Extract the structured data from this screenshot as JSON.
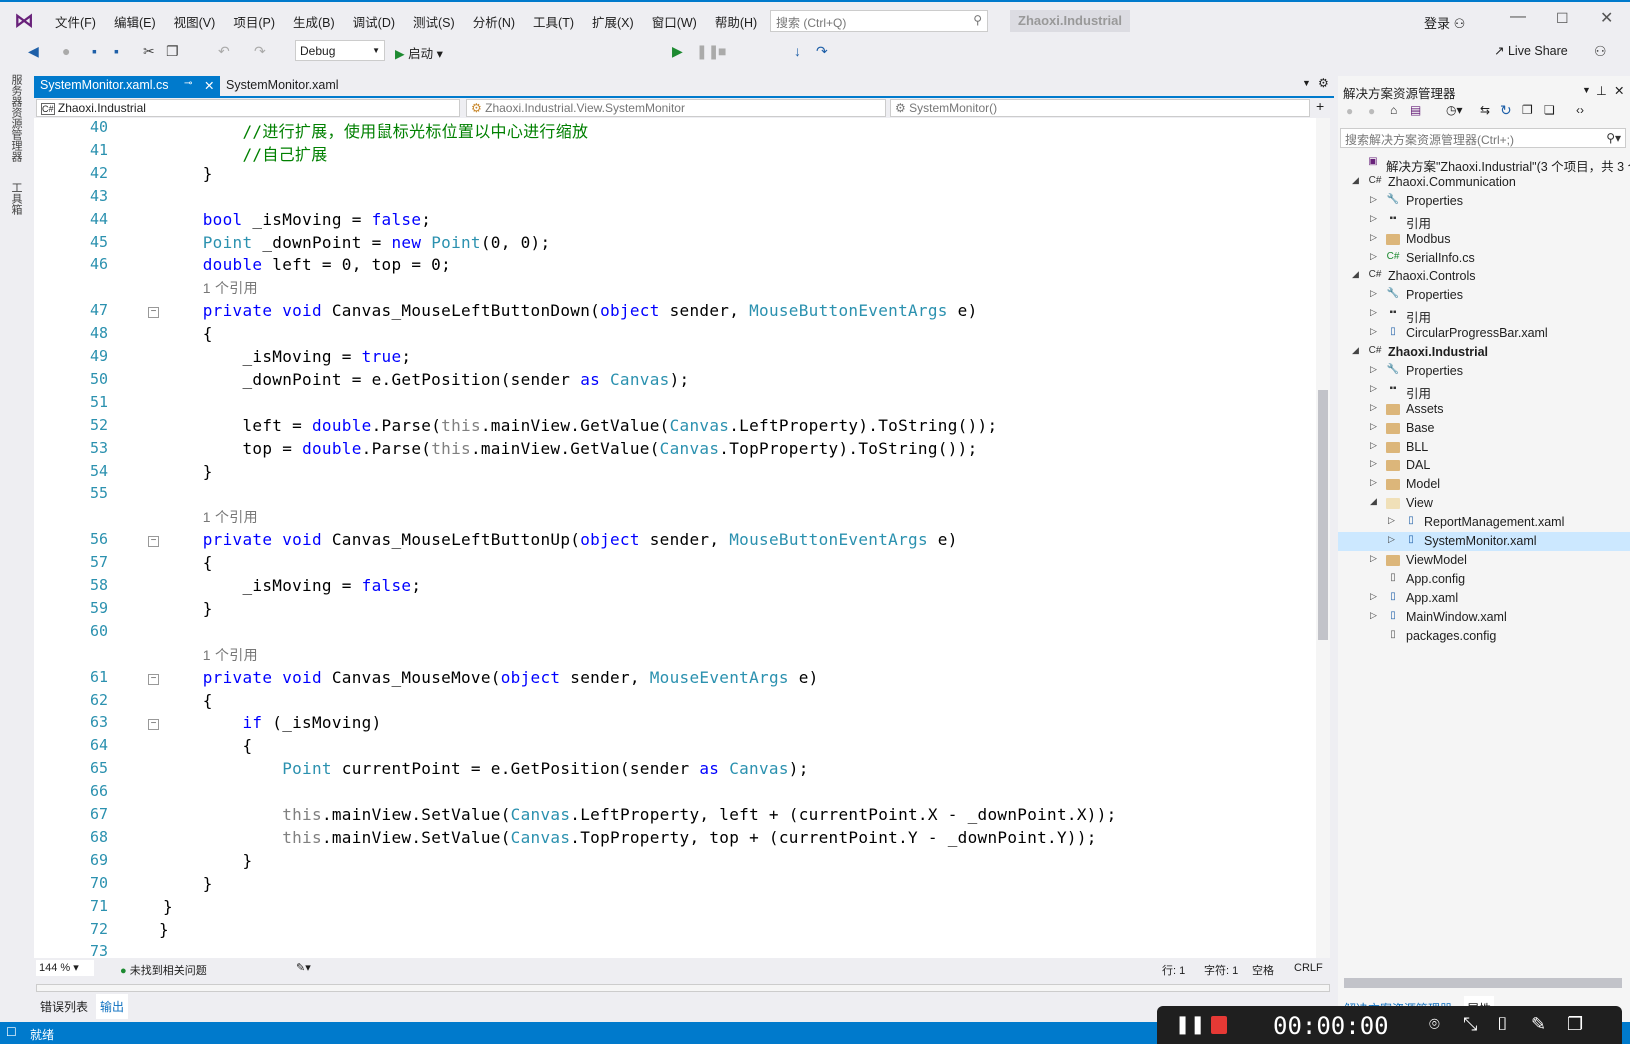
{
  "titlebar": {
    "menu": [
      "文件(F)",
      "编辑(E)",
      "视图(V)",
      "项目(P)",
      "生成(B)",
      "调试(D)",
      "测试(S)",
      "分析(N)",
      "工具(T)",
      "扩展(X)",
      "窗口(W)",
      "帮助(H)"
    ],
    "search_placeholder": "搜索 (Ctrl+Q)",
    "project": "Zhaoxi.Industrial",
    "login": "登录",
    "live_share": "Live Share"
  },
  "toolbar": {
    "config": "Debug",
    "start": "启动"
  },
  "left_strip": [
    "服务器资源管理器",
    "工具箱"
  ],
  "tabs": [
    {
      "label": "SystemMonitor.xaml.cs",
      "active": true
    },
    {
      "label": "SystemMonitor.xaml",
      "active": false
    }
  ],
  "navbar": {
    "project": "Zhaoxi.Industrial",
    "class": "Zhaoxi.Industrial.View.SystemMonitor",
    "member": "SystemMonitor()"
  },
  "code": [
    {
      "n": "40",
      "t": [
        [
          "cm",
          "        //进行扩展，使用鼠标光标位置以中心进行缩放"
        ]
      ]
    },
    {
      "n": "41",
      "t": [
        [
          "cm",
          "        //自己扩展"
        ]
      ]
    },
    {
      "n": "42",
      "t": [
        [
          "",
          "    }"
        ]
      ]
    },
    {
      "n": "43",
      "t": []
    },
    {
      "n": "44",
      "t": [
        [
          "kw",
          "    bool"
        ],
        [
          "",
          " _isMoving = "
        ],
        [
          "kw",
          "false"
        ],
        [
          "",
          ";"
        ]
      ]
    },
    {
      "n": "45",
      "t": [
        [
          "ty",
          "    Point"
        ],
        [
          "",
          " _downPoint = "
        ],
        [
          "kw",
          "new "
        ],
        [
          "ty",
          "Point"
        ],
        [
          "",
          "(0, 0);"
        ]
      ]
    },
    {
      "n": "46",
      "t": [
        [
          "kw",
          "    double"
        ],
        [
          "",
          " left = 0, top = 0;"
        ]
      ]
    },
    {
      "n": "",
      "ref": "1 个引用"
    },
    {
      "n": "47",
      "fold": true,
      "t": [
        [
          "kw",
          "    private void"
        ],
        [
          "",
          " Canvas_MouseLeftButtonDown("
        ],
        [
          "kw",
          "object"
        ],
        [
          "",
          " sender, "
        ],
        [
          "ty",
          "MouseButtonEventArgs"
        ],
        [
          "",
          " e)"
        ]
      ]
    },
    {
      "n": "48",
      "t": [
        [
          "",
          "    {"
        ]
      ]
    },
    {
      "n": "49",
      "t": [
        [
          "",
          "        _isMoving = "
        ],
        [
          "kw",
          "true"
        ],
        [
          "",
          ";"
        ]
      ]
    },
    {
      "n": "50",
      "t": [
        [
          "",
          "        _downPoint = e.GetPosition(sender "
        ],
        [
          "kw",
          "as "
        ],
        [
          "ty",
          "Canvas"
        ],
        [
          "",
          ");"
        ]
      ]
    },
    {
      "n": "51",
      "t": []
    },
    {
      "n": "52",
      "t": [
        [
          "",
          "        left = "
        ],
        [
          "kw",
          "double"
        ],
        [
          "",
          ".Parse("
        ],
        [
          "gr",
          "this"
        ],
        [
          "",
          ".mainView.GetValue("
        ],
        [
          "ty",
          "Canvas"
        ],
        [
          "",
          ".LeftProperty).ToString());"
        ]
      ]
    },
    {
      "n": "53",
      "t": [
        [
          "",
          "        top = "
        ],
        [
          "kw",
          "double"
        ],
        [
          "",
          ".Parse("
        ],
        [
          "gr",
          "this"
        ],
        [
          "",
          ".mainView.GetValue("
        ],
        [
          "ty",
          "Canvas"
        ],
        [
          "",
          ".TopProperty).ToString());"
        ]
      ]
    },
    {
      "n": "54",
      "t": [
        [
          "",
          "    }"
        ]
      ]
    },
    {
      "n": "55",
      "t": []
    },
    {
      "n": "",
      "ref": "1 个引用"
    },
    {
      "n": "56",
      "fold": true,
      "t": [
        [
          "kw",
          "    private void"
        ],
        [
          "",
          " Canvas_MouseLeftButtonUp("
        ],
        [
          "kw",
          "object"
        ],
        [
          "",
          " sender, "
        ],
        [
          "ty",
          "MouseButtonEventArgs"
        ],
        [
          "",
          " e)"
        ]
      ]
    },
    {
      "n": "57",
      "t": [
        [
          "",
          "    {"
        ]
      ]
    },
    {
      "n": "58",
      "t": [
        [
          "",
          "        _isMoving = "
        ],
        [
          "kw",
          "false"
        ],
        [
          "",
          ";"
        ]
      ]
    },
    {
      "n": "59",
      "t": [
        [
          "",
          "    }"
        ]
      ]
    },
    {
      "n": "60",
      "t": []
    },
    {
      "n": "",
      "ref": "1 个引用"
    },
    {
      "n": "61",
      "fold": true,
      "t": [
        [
          "kw",
          "    private void"
        ],
        [
          "",
          " Canvas_MouseMove("
        ],
        [
          "kw",
          "object"
        ],
        [
          "",
          " sender, "
        ],
        [
          "ty",
          "MouseEventArgs"
        ],
        [
          "",
          " e)"
        ]
      ]
    },
    {
      "n": "62",
      "t": [
        [
          "",
          "    {"
        ]
      ]
    },
    {
      "n": "63",
      "fold": true,
      "t": [
        [
          "kw",
          "        if"
        ],
        [
          "",
          " (_isMoving)"
        ]
      ]
    },
    {
      "n": "64",
      "t": [
        [
          "",
          "        {"
        ]
      ]
    },
    {
      "n": "65",
      "t": [
        [
          "ty",
          "            Point"
        ],
        [
          "",
          " currentPoint = e.GetPosition(sender "
        ],
        [
          "kw",
          "as "
        ],
        [
          "ty",
          "Canvas"
        ],
        [
          "",
          ");"
        ]
      ]
    },
    {
      "n": "66",
      "t": []
    },
    {
      "n": "67",
      "t": [
        [
          "gr",
          "            this"
        ],
        [
          "",
          ".mainView.SetValue("
        ],
        [
          "ty",
          "Canvas"
        ],
        [
          "",
          ".LeftProperty, left + (currentPoint.X - _downPoint.X));"
        ]
      ]
    },
    {
      "n": "68",
      "t": [
        [
          "gr",
          "            this"
        ],
        [
          "",
          ".mainView.SetValue("
        ],
        [
          "ty",
          "Canvas"
        ],
        [
          "",
          ".TopProperty, top + (currentPoint.Y - _downPoint.Y));"
        ]
      ]
    },
    {
      "n": "69",
      "t": [
        [
          "",
          "        }"
        ]
      ]
    },
    {
      "n": "70",
      "t": [
        [
          "",
          "    }"
        ]
      ]
    },
    {
      "n": "71",
      "t": [
        [
          "",
          "}"
        ]
      ]
    },
    {
      "n": "72",
      "t": [
        [
          "",
          "}"
        ]
      ],
      "neg": true
    },
    {
      "n": "73",
      "t": []
    }
  ],
  "editor_status": {
    "zoom": "144 %",
    "issues": "未找到相关问题",
    "line": "行: 1",
    "char": "字符: 1",
    "spaces": "空格",
    "eol": "CRLF"
  },
  "bottom_tabs": [
    "错误列表",
    "输出"
  ],
  "status": {
    "text": "就绪"
  },
  "solution_explorer": {
    "title": "解决方案资源管理器",
    "search_placeholder": "搜索解决方案资源管理器(Ctrl+;)",
    "tree": [
      {
        "d": 0,
        "tri": "",
        "icon": "solution",
        "label": "解决方案\"Zhaoxi.Industrial\"(3 个项目，共 3 个"
      },
      {
        "d": 1,
        "tri": "open",
        "icon": "csproj",
        "label": "Zhaoxi.Communication"
      },
      {
        "d": 2,
        "tri": "closed",
        "icon": "wrench",
        "label": "Properties"
      },
      {
        "d": 2,
        "tri": "closed",
        "icon": "refs",
        "label": "引用"
      },
      {
        "d": 2,
        "tri": "closed",
        "icon": "folder",
        "label": "Modbus"
      },
      {
        "d": 2,
        "tri": "closed",
        "icon": "cs",
        "label": "SerialInfo.cs"
      },
      {
        "d": 1,
        "tri": "open",
        "icon": "csproj",
        "label": "Zhaoxi.Controls"
      },
      {
        "d": 2,
        "tri": "closed",
        "icon": "wrench",
        "label": "Properties"
      },
      {
        "d": 2,
        "tri": "closed",
        "icon": "refs",
        "label": "引用"
      },
      {
        "d": 2,
        "tri": "closed",
        "icon": "xaml",
        "label": "CircularProgressBar.xaml"
      },
      {
        "d": 1,
        "tri": "open",
        "icon": "csproj",
        "label": "Zhaoxi.Industrial",
        "bold": true
      },
      {
        "d": 2,
        "tri": "closed",
        "icon": "wrench",
        "label": "Properties"
      },
      {
        "d": 2,
        "tri": "closed",
        "icon": "refs",
        "label": "引用"
      },
      {
        "d": 2,
        "tri": "closed",
        "icon": "folder",
        "label": "Assets"
      },
      {
        "d": 2,
        "tri": "closed",
        "icon": "folder",
        "label": "Base"
      },
      {
        "d": 2,
        "tri": "closed",
        "icon": "folder",
        "label": "BLL"
      },
      {
        "d": 2,
        "tri": "closed",
        "icon": "folder",
        "label": "DAL"
      },
      {
        "d": 2,
        "tri": "closed",
        "icon": "folder",
        "label": "Model"
      },
      {
        "d": 2,
        "tri": "open",
        "icon": "folder-open",
        "label": "View"
      },
      {
        "d": 3,
        "tri": "closed",
        "icon": "xaml",
        "label": "ReportManagement.xaml"
      },
      {
        "d": 3,
        "tri": "closed",
        "icon": "xaml",
        "label": "SystemMonitor.xaml",
        "selected": true
      },
      {
        "d": 2,
        "tri": "closed",
        "icon": "folder",
        "label": "ViewModel"
      },
      {
        "d": 2,
        "tri": "",
        "icon": "config",
        "label": "App.config"
      },
      {
        "d": 2,
        "tri": "closed",
        "icon": "xaml",
        "label": "App.xaml"
      },
      {
        "d": 2,
        "tri": "closed",
        "icon": "xaml",
        "label": "MainWindow.xaml"
      },
      {
        "d": 2,
        "tri": "",
        "icon": "config",
        "label": "packages.config"
      }
    ],
    "bottom_tabs": [
      "解决方案资源管理器",
      "属性"
    ]
  },
  "recorder": {
    "time": "00:00:00"
  },
  "colors": {
    "accent": "#007acc",
    "keyword": "#0000ff",
    "type": "#2b91af",
    "comment": "#008000",
    "record": "#e53935"
  }
}
